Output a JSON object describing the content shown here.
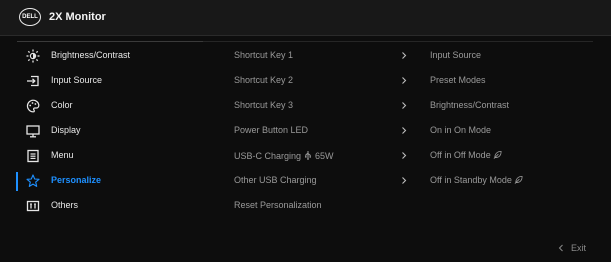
{
  "header": {
    "logo_text": "DELL",
    "title": "2X Monitor"
  },
  "menu": [
    {
      "label": "Brightness/Contrast",
      "icon": "brightness-icon"
    },
    {
      "label": "Input Source",
      "icon": "input-source-icon"
    },
    {
      "label": "Color",
      "icon": "color-palette-icon"
    },
    {
      "label": "Display",
      "icon": "display-icon"
    },
    {
      "label": "Menu",
      "icon": "menu-icon"
    },
    {
      "label": "Personalize",
      "icon": "star-icon",
      "active": true
    },
    {
      "label": "Others",
      "icon": "others-icon"
    }
  ],
  "personalize": {
    "rows": [
      {
        "key": "Shortcut Key 1",
        "value": "Input Source"
      },
      {
        "key": "Shortcut Key 2",
        "value": "Preset Modes"
      },
      {
        "key": "Shortcut Key 3",
        "value": "Brightness/Contrast"
      },
      {
        "key": "Power Button LED",
        "value": "On in On Mode"
      },
      {
        "key_prefix": "USB-C Charging",
        "key_suffix": "65W",
        "value": "Off in Off Mode"
      },
      {
        "key": "Other USB Charging",
        "value": "Off in Standby Mode"
      },
      {
        "key": "Reset Personalization"
      }
    ]
  },
  "footer": {
    "exit_label": "Exit"
  },
  "colors": {
    "accent": "#1e90ff",
    "background": "#0d0d0d",
    "header": "#181818"
  }
}
